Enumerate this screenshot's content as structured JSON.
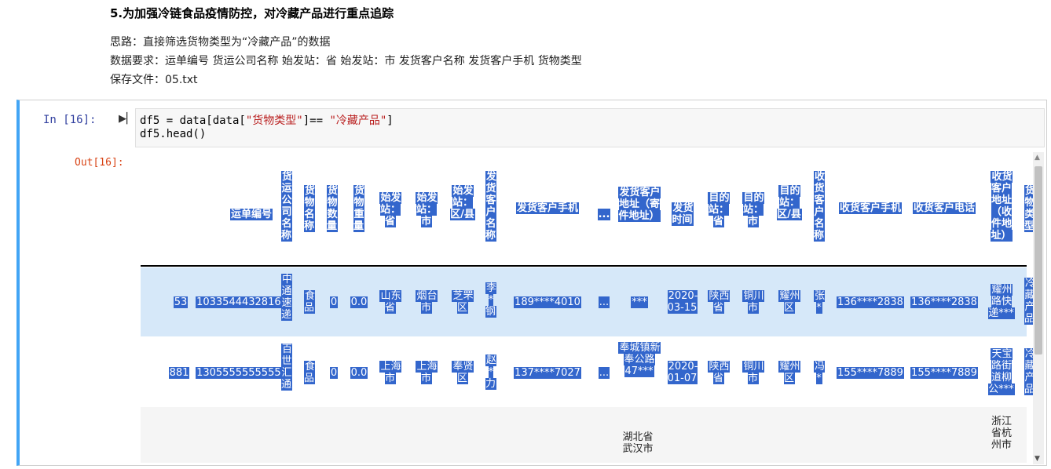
{
  "markdown": {
    "title": "5.为加强冷链食品疫情防控，对冷藏产品进行重点追踪",
    "line1": "思路：直接筛选货物类型为“冷藏产品”的数据",
    "line2": "数据要求：运单编号 货运公司名称 始发站：省 始发站：市 发货客户名称 发货客户手机 货物类型",
    "line3": "保存文件：05.txt"
  },
  "cell": {
    "in_prompt": "In  [16]:",
    "code": {
      "l1_a": "df5 = data[data[",
      "l1_b": "\"货物类型\"",
      "l1_c": "]== ",
      "l1_d": "\"冷藏产品\"",
      "l1_e": "]",
      "l2": "df5.head()"
    },
    "out_prompt": "Out[16]:"
  },
  "table": {
    "headers": {
      "waybill": "运单编号",
      "company": "货运公司名称",
      "goods_name": "货物名称",
      "goods_qty": "货物数量",
      "goods_weight": "货物重量",
      "origin_province": "始发站：省",
      "origin_city": "始发站：市",
      "origin_district": "始发站：区/县",
      "sender_name": "发货客户名称",
      "sender_phone": "发货客户手机",
      "ellipsis": "...",
      "sender_address": "发货客户地址（寄件地址）",
      "send_time": "发货时间",
      "dest_province": "目的站：省",
      "dest_city": "目的站：市",
      "dest_district": "目的站：区/县",
      "receiver_name": "收货客户名称",
      "receiver_phone": "收货客户手机",
      "receiver_tel": "收货客户电话",
      "receiver_address": "收货客户地址（收件地址）",
      "goods_type": "货物类型"
    },
    "rows": [
      {
        "index": "53",
        "waybill": "10335444328166",
        "company": "中通速递",
        "goods_name": "食品",
        "goods_qty": "0",
        "goods_weight": "0.0",
        "origin_province": "山东省",
        "origin_city": "烟台市",
        "origin_district": "芝罘区",
        "sender_name": "李*钢",
        "sender_phone": "189****4010",
        "ellipsis": "...",
        "sender_address": "***",
        "send_time": "2020-03-15",
        "dest_province": "陕西省",
        "dest_city": "铜川市",
        "dest_district": "耀州区",
        "receiver_name": "张*",
        "receiver_phone": "136****2838",
        "receiver_tel": "136****2838",
        "receiver_address": "耀州路快递***",
        "goods_type": "冷藏产品"
      },
      {
        "index": "881",
        "waybill": "13055555555555",
        "company": "百世汇通",
        "goods_name": "食品",
        "goods_qty": "0",
        "goods_weight": "0.0",
        "origin_province": "上海市",
        "origin_city": "上海市",
        "origin_district": "奉贤区",
        "sender_name": "赵*力",
        "sender_phone": "137****7027",
        "ellipsis": "...",
        "sender_address": "奉城镇新奉公路47***",
        "send_time": "2020-01-07",
        "dest_province": "陕西省",
        "dest_city": "铜川市",
        "dest_district": "耀州区",
        "receiver_name": "冯*",
        "receiver_phone": "155****7889",
        "receiver_tel": "155****7889",
        "receiver_address": "天宝路街道柳公***",
        "goods_type": "冷藏产品"
      },
      {
        "sender_address": "湖北省武汉市",
        "receiver_address": "浙江省杭州市"
      }
    ]
  }
}
